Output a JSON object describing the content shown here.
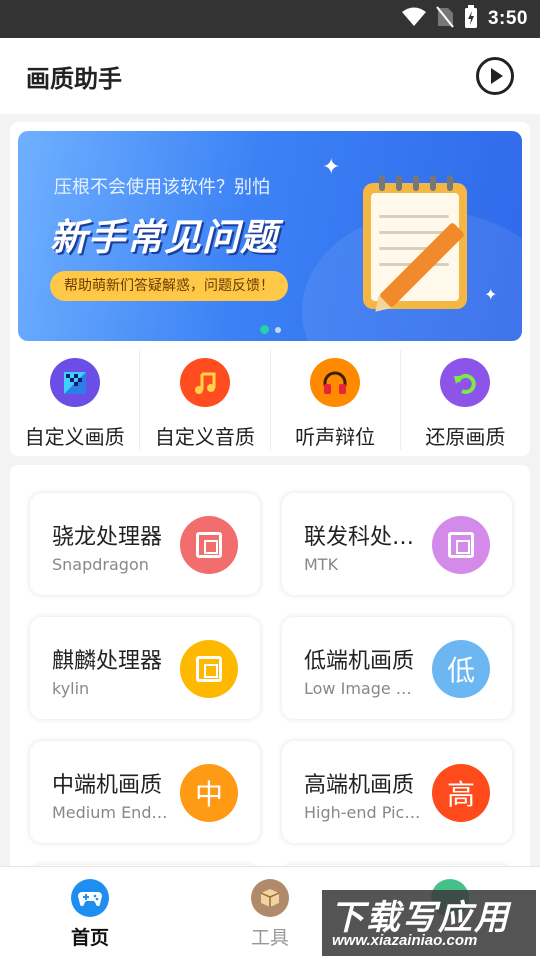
{
  "status_bar": {
    "time": "3:50",
    "icons": [
      "wifi-icon",
      "no-sim-icon",
      "battery-charging-icon"
    ]
  },
  "app_bar": {
    "title": "画质助手",
    "action_icon": "play-circle-icon"
  },
  "banner": {
    "subtitle": "压根不会使用该软件？别怕",
    "headline": "新手常见问题",
    "pill": "帮助萌新们答疑解惑，问题反馈！",
    "page_count": 2,
    "active_page": 1
  },
  "quick_actions": [
    {
      "label": "自定义画质",
      "icon": "picture-quality-icon",
      "color": "#6a4ee6"
    },
    {
      "label": "自定义音质",
      "icon": "music-note-icon",
      "color": "#ff4d1f"
    },
    {
      "label": "听声辩位",
      "icon": "headphones-icon",
      "color": "#ff8a00"
    },
    {
      "label": "还原画质",
      "icon": "undo-icon",
      "color": "#8c54e8"
    }
  ],
  "tiles": [
    {
      "title": "骁龙处理器",
      "subtitle": "Snapdragon",
      "icon": "chip-icon",
      "glyph": "",
      "color": "#f26d6d"
    },
    {
      "title": "联发科处理器",
      "subtitle": "MTK",
      "icon": "chip-icon",
      "glyph": "",
      "color": "#d48ae8"
    },
    {
      "title": "麒麟处理器",
      "subtitle": "kylin",
      "icon": "chip-icon",
      "glyph": "",
      "color": "#ffb800"
    },
    {
      "title": "低端机画质",
      "subtitle": "Low Image Quality",
      "icon": "low-badge-icon",
      "glyph": "低",
      "color": "#6cb6f2"
    },
    {
      "title": "中端机画质",
      "subtitle": "Medium End Quality",
      "icon": "mid-badge-icon",
      "glyph": "中",
      "color": "#ff9a14"
    },
    {
      "title": "高端机画质",
      "subtitle": "High-end Picture Quality",
      "icon": "high-badge-icon",
      "glyph": "高",
      "color": "#ff4a1c"
    }
  ],
  "bottom_nav": [
    {
      "label": "首页",
      "icon": "gamepad-icon",
      "active": true,
      "color": "#1e8ff0"
    },
    {
      "label": "工具",
      "icon": "box-icon",
      "active": false,
      "color": "#b08a6a"
    },
    {
      "label": "",
      "icon": "more-icon",
      "active": false,
      "color": "#46c08a"
    }
  ],
  "watermark": {
    "text": "下载写应用",
    "url": "www.xiazainiao.com"
  }
}
